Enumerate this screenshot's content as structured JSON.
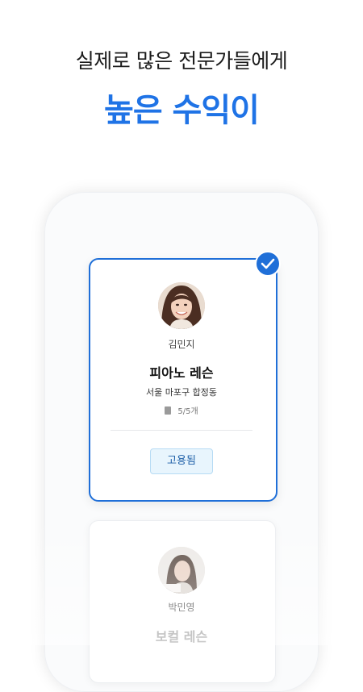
{
  "header": {
    "subtitle": "실제로 많은 전문가들에게",
    "headline": "높은 수익이"
  },
  "cards": [
    {
      "name": "김민지",
      "title": "피아노 레슨",
      "location": "서울 마포구 합정동",
      "count": "5/5개",
      "status_button": "고용됨",
      "selected": true
    },
    {
      "name": "박민영",
      "title": "보컬 레슨"
    }
  ],
  "colors": {
    "accent": "#1f73e6",
    "card_border_selected": "#1f6fd8",
    "hired_bg": "#e8f5fd",
    "hired_text": "#1d5fa8"
  },
  "icons": {
    "check": "check-circle-icon",
    "document": "document-icon"
  }
}
